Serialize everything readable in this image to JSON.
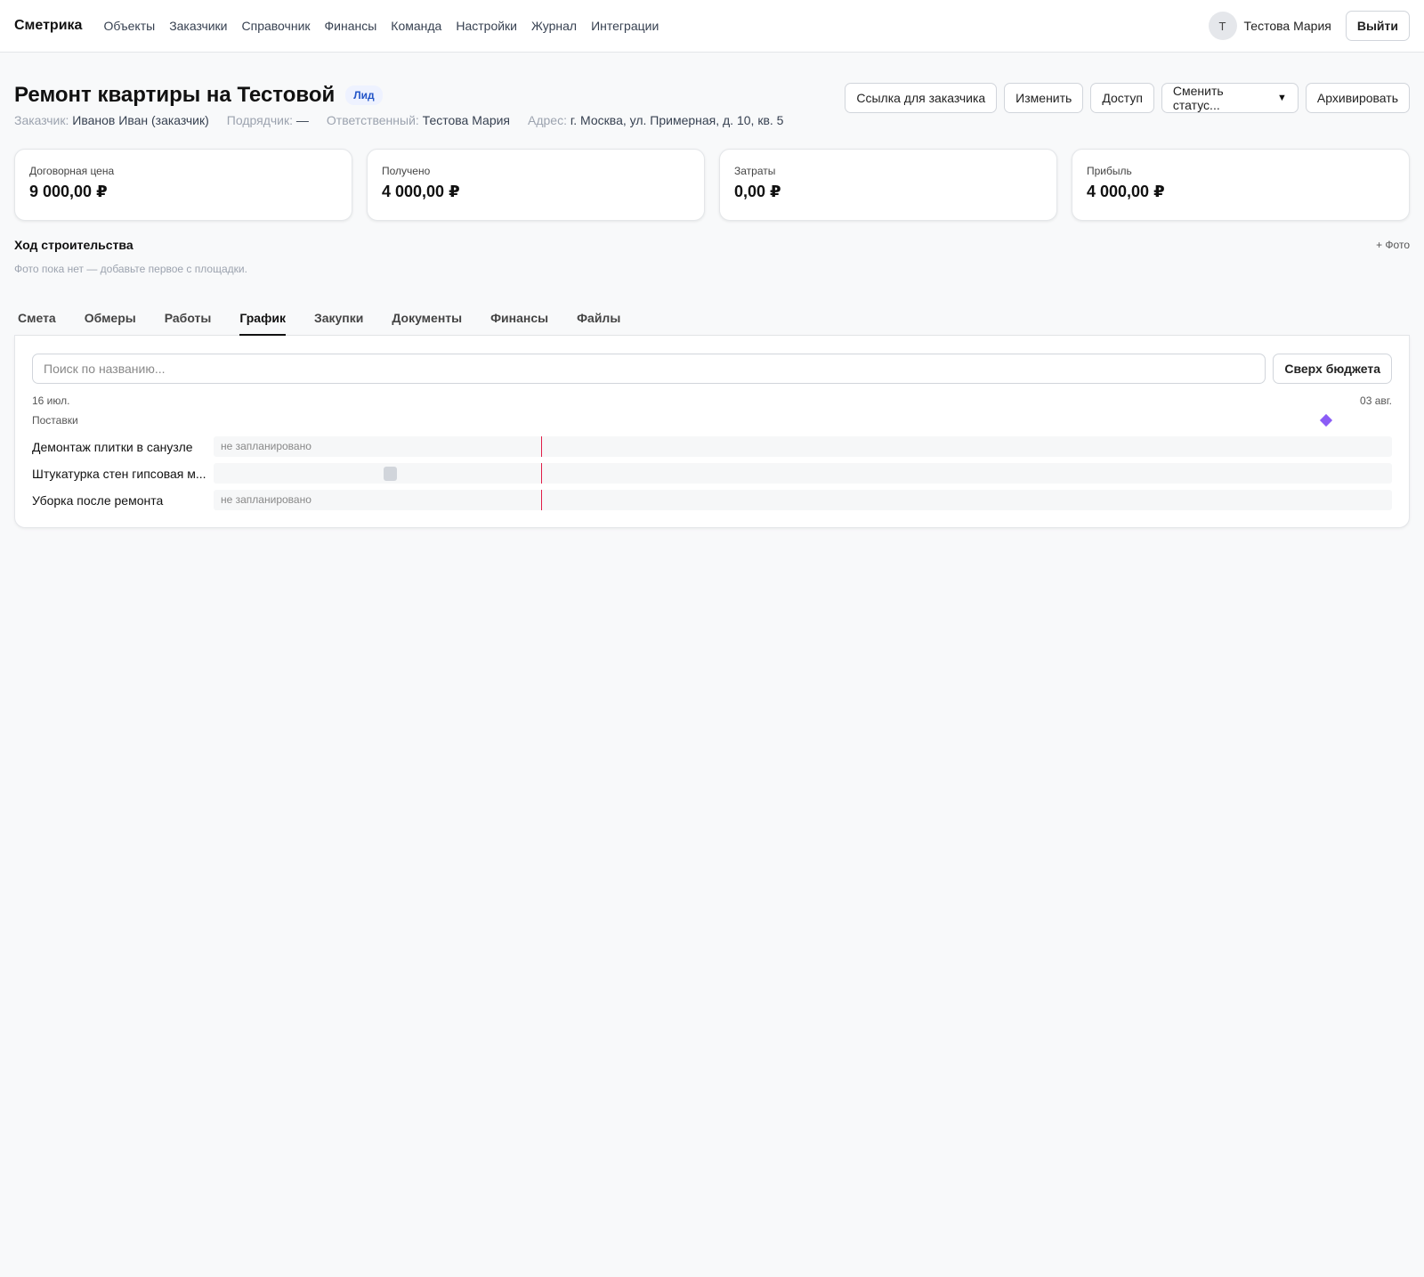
{
  "brand": "Сметрика",
  "nav": [
    "Объекты",
    "Заказчики",
    "Справочник",
    "Финансы",
    "Команда",
    "Настройки",
    "Журнал",
    "Интеграции"
  ],
  "user": {
    "initial": "Т",
    "name": "Тестова Мария",
    "logout": "Выйти"
  },
  "project": {
    "title": "Ремонт квартиры на Тестовой",
    "status_badge": "Лид",
    "actions": {
      "client_link": "Ссылка для заказчика",
      "edit": "Изменить",
      "access": "Доступ",
      "change_status": "Сменить статус...",
      "archive": "Архивировать"
    },
    "meta": [
      {
        "key": "Заказчик:",
        "value": "Иванов Иван (заказчик)"
      },
      {
        "key": "Подрядчик:",
        "value": "—"
      },
      {
        "key": "Ответственный:",
        "value": "Тестова Мария"
      },
      {
        "key": "Адрес:",
        "value": "г. Москва, ул. Примерная, д. 10, кв. 5"
      }
    ]
  },
  "cards": [
    {
      "label": "Договорная цена",
      "value": "9 000,00 ₽"
    },
    {
      "label": "Получено",
      "value": "4 000,00 ₽"
    },
    {
      "label": "Затраты",
      "value": "0,00 ₽"
    },
    {
      "label": "Прибыль",
      "value": "4 000,00 ₽"
    }
  ],
  "progress": {
    "title": "Ход строительства",
    "add_photo": "+ Фото",
    "empty_text": "Фото пока нет — добавьте первое с площадки."
  },
  "tabs": [
    {
      "label": "Смета",
      "active": false
    },
    {
      "label": "Обмеры",
      "active": false
    },
    {
      "label": "Работы",
      "active": false
    },
    {
      "label": "График",
      "active": true
    },
    {
      "label": "Закупки",
      "active": false
    },
    {
      "label": "Документы",
      "active": false
    },
    {
      "label": "Финансы",
      "active": false
    },
    {
      "label": "Файлы",
      "active": false
    }
  ],
  "schedule": {
    "search_placeholder": "Поиск по названию...",
    "over_budget_button": "Сверх бюджета",
    "date_start": "16 июл.",
    "date_end": "03 авг.",
    "deliveries_label": "Поставки",
    "delivery_day": 17,
    "today_day": 5,
    "span_days": 18,
    "rows": [
      {
        "name": "Демонтаж плитки в санузле",
        "status": "не запланировано",
        "planned": false
      },
      {
        "name": "Штукатурка стен гипсовая м...",
        "status": "",
        "planned": true,
        "start_day": 2.6,
        "duration_days": 0.2
      },
      {
        "name": "Уборка после ремонта",
        "status": "не запланировано",
        "planned": false
      }
    ],
    "colors": {
      "delivery": "#8b5cf6",
      "today": "#e11d48",
      "bar": "#d1d5db"
    }
  }
}
